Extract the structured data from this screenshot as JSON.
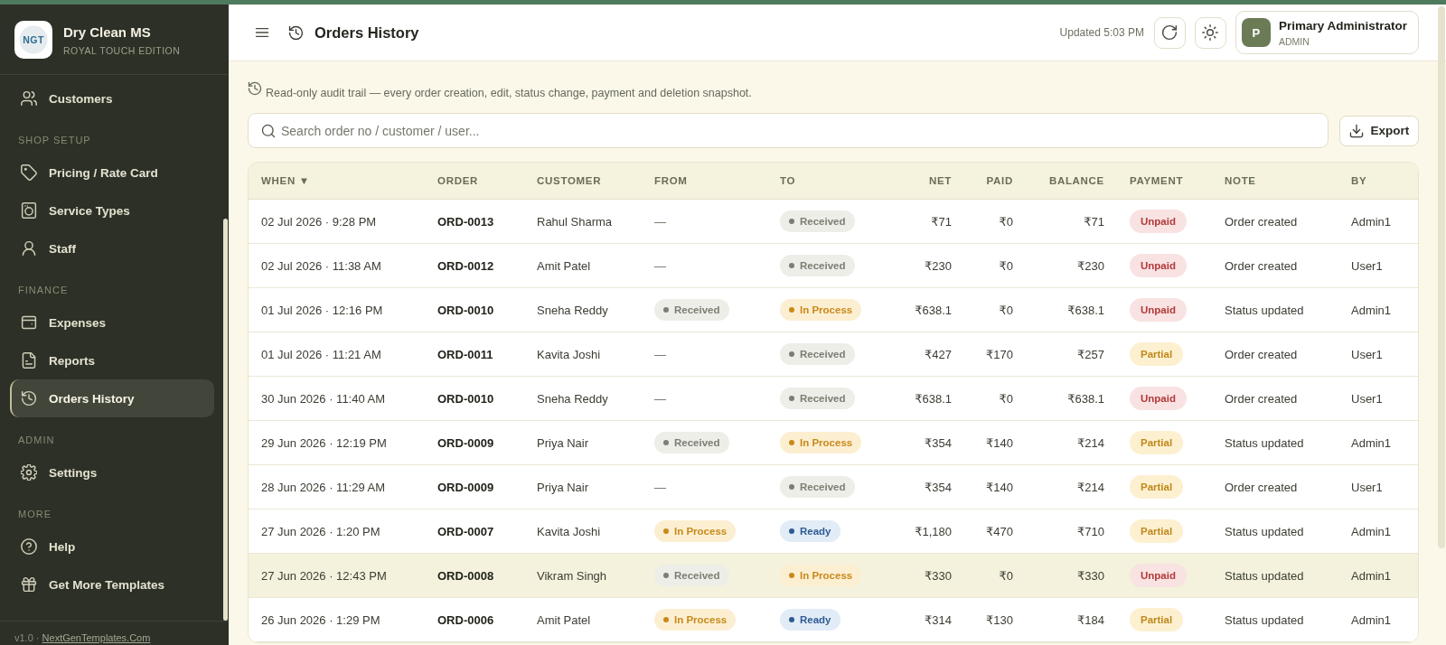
{
  "app": {
    "logo_text": "NGT",
    "title": "Dry Clean MS",
    "subtitle": "ROYAL TOUCH EDITION"
  },
  "sidebar": {
    "sections": [
      {
        "items": [
          {
            "label": "Customers",
            "selected": false
          }
        ]
      },
      {
        "heading": "SHOP SETUP",
        "items": [
          {
            "label": "Pricing / Rate Card",
            "selected": false
          },
          {
            "label": "Service Types",
            "selected": false
          },
          {
            "label": "Staff",
            "selected": false
          }
        ]
      },
      {
        "heading": "FINANCE",
        "items": [
          {
            "label": "Expenses",
            "selected": false
          },
          {
            "label": "Reports",
            "selected": false
          },
          {
            "label": "Orders History",
            "selected": true
          }
        ]
      },
      {
        "heading": "ADMIN",
        "items": [
          {
            "label": "Settings",
            "selected": false
          }
        ]
      },
      {
        "heading": "MORE",
        "items": [
          {
            "label": "Help",
            "selected": false
          },
          {
            "label": "Get More Templates",
            "selected": false
          }
        ]
      }
    ],
    "footer": {
      "version": "v1.0 ·",
      "link": "NextGenTemplates.Com"
    }
  },
  "header": {
    "title": "Orders History",
    "updated": "Updated 5:03 PM",
    "user": {
      "initial": "P",
      "name": "Primary Administrator",
      "role": "ADMIN"
    }
  },
  "notice": "Read-only audit trail — every order creation, edit, status change, payment and deletion snapshot.",
  "search": {
    "placeholder": "Search order no / customer / user..."
  },
  "export_button": "Export",
  "table": {
    "columns": [
      "WHEN ▼",
      "ORDER",
      "CUSTOMER",
      "FROM",
      "TO",
      "NET",
      "PAID",
      "BALANCE",
      "PAYMENT",
      "NOTE",
      "BY"
    ],
    "rows": [
      {
        "when": "02 Jul 2026 · 9:28 PM",
        "order": "ORD-0013",
        "customer": "Rahul Sharma",
        "from": {
          "label": "—",
          "kind": "none"
        },
        "to": {
          "label": "Received",
          "kind": "received"
        },
        "net": "₹71",
        "paid": "₹0",
        "balance": "₹71",
        "payment": {
          "label": "Unpaid",
          "kind": "unpaid"
        },
        "note": "Order created",
        "by": "Admin1",
        "highlighted": false
      },
      {
        "when": "02 Jul 2026 · 11:38 AM",
        "order": "ORD-0012",
        "customer": "Amit Patel",
        "from": {
          "label": "—",
          "kind": "none"
        },
        "to": {
          "label": "Received",
          "kind": "received"
        },
        "net": "₹230",
        "paid": "₹0",
        "balance": "₹230",
        "payment": {
          "label": "Unpaid",
          "kind": "unpaid"
        },
        "note": "Order created",
        "by": "User1",
        "highlighted": false
      },
      {
        "when": "01 Jul 2026 · 12:16 PM",
        "order": "ORD-0010",
        "customer": "Sneha Reddy",
        "from": {
          "label": "Received",
          "kind": "received"
        },
        "to": {
          "label": "In Process",
          "kind": "in_process"
        },
        "net": "₹638.1",
        "paid": "₹0",
        "balance": "₹638.1",
        "payment": {
          "label": "Unpaid",
          "kind": "unpaid"
        },
        "note": "Status updated",
        "by": "Admin1",
        "highlighted": false
      },
      {
        "when": "01 Jul 2026 · 11:21 AM",
        "order": "ORD-0011",
        "customer": "Kavita Joshi",
        "from": {
          "label": "—",
          "kind": "none"
        },
        "to": {
          "label": "Received",
          "kind": "received"
        },
        "net": "₹427",
        "paid": "₹170",
        "balance": "₹257",
        "payment": {
          "label": "Partial",
          "kind": "partial"
        },
        "note": "Order created",
        "by": "User1",
        "highlighted": false
      },
      {
        "when": "30 Jun 2026 · 11:40 AM",
        "order": "ORD-0010",
        "customer": "Sneha Reddy",
        "from": {
          "label": "—",
          "kind": "none"
        },
        "to": {
          "label": "Received",
          "kind": "received"
        },
        "net": "₹638.1",
        "paid": "₹0",
        "balance": "₹638.1",
        "payment": {
          "label": "Unpaid",
          "kind": "unpaid"
        },
        "note": "Order created",
        "by": "User1",
        "highlighted": false
      },
      {
        "when": "29 Jun 2026 · 12:19 PM",
        "order": "ORD-0009",
        "customer": "Priya Nair",
        "from": {
          "label": "Received",
          "kind": "received"
        },
        "to": {
          "label": "In Process",
          "kind": "in_process"
        },
        "net": "₹354",
        "paid": "₹140",
        "balance": "₹214",
        "payment": {
          "label": "Partial",
          "kind": "partial"
        },
        "note": "Status updated",
        "by": "Admin1",
        "highlighted": false
      },
      {
        "when": "28 Jun 2026 · 11:29 AM",
        "order": "ORD-0009",
        "customer": "Priya Nair",
        "from": {
          "label": "—",
          "kind": "none"
        },
        "to": {
          "label": "Received",
          "kind": "received"
        },
        "net": "₹354",
        "paid": "₹140",
        "balance": "₹214",
        "payment": {
          "label": "Partial",
          "kind": "partial"
        },
        "note": "Order created",
        "by": "User1",
        "highlighted": false
      },
      {
        "when": "27 Jun 2026 · 1:20 PM",
        "order": "ORD-0007",
        "customer": "Kavita Joshi",
        "from": {
          "label": "In Process",
          "kind": "in_process"
        },
        "to": {
          "label": "Ready",
          "kind": "ready"
        },
        "net": "₹1,180",
        "paid": "₹470",
        "balance": "₹710",
        "payment": {
          "label": "Partial",
          "kind": "partial"
        },
        "note": "Status updated",
        "by": "Admin1",
        "highlighted": false
      },
      {
        "when": "27 Jun 2026 · 12:43 PM",
        "order": "ORD-0008",
        "customer": "Vikram Singh",
        "from": {
          "label": "Received",
          "kind": "received"
        },
        "to": {
          "label": "In Process",
          "kind": "in_process"
        },
        "net": "₹330",
        "paid": "₹0",
        "balance": "₹330",
        "payment": {
          "label": "Unpaid",
          "kind": "unpaid"
        },
        "note": "Status updated",
        "by": "Admin1",
        "highlighted": true
      },
      {
        "when": "26 Jun 2026 · 1:29 PM",
        "order": "ORD-0006",
        "customer": "Amit Patel",
        "from": {
          "label": "In Process",
          "kind": "in_process"
        },
        "to": {
          "label": "Ready",
          "kind": "ready"
        },
        "net": "₹314",
        "paid": "₹130",
        "balance": "₹184",
        "payment": {
          "label": "Partial",
          "kind": "partial"
        },
        "note": "Status updated",
        "by": "Admin1",
        "highlighted": false
      }
    ]
  }
}
